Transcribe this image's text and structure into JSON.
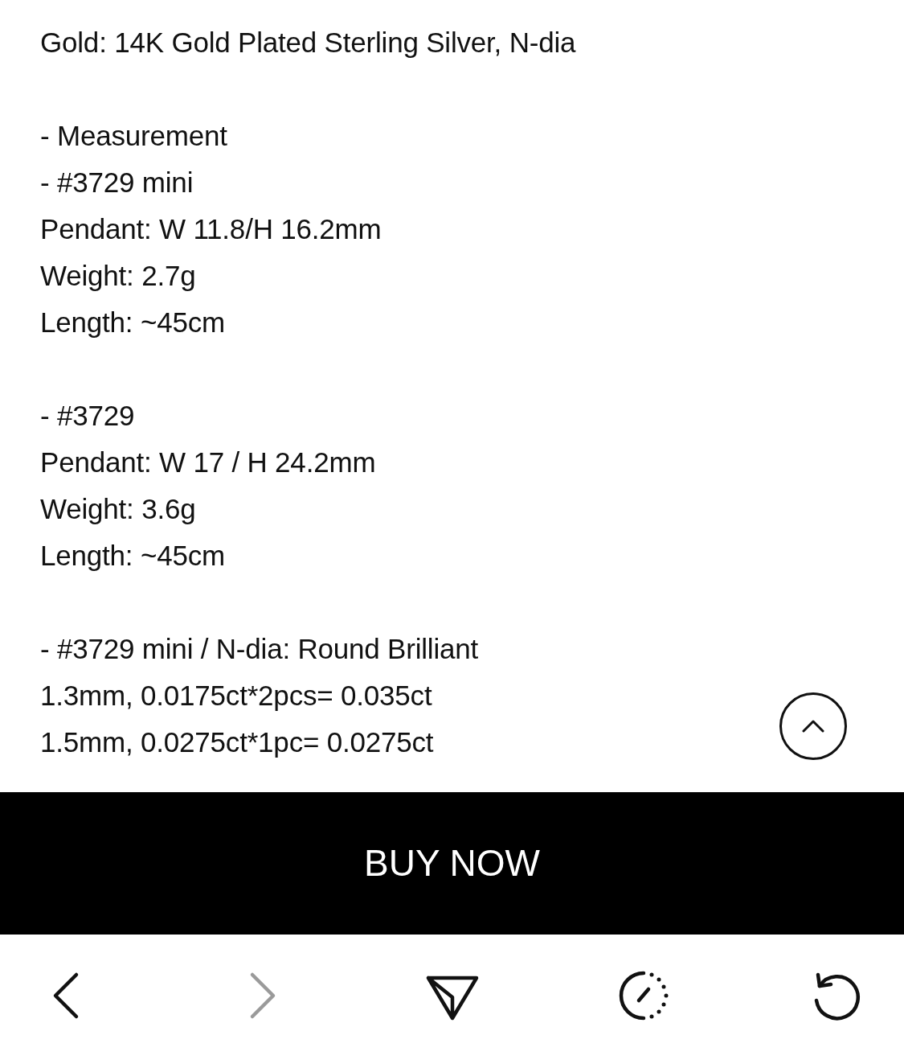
{
  "description": {
    "sections": [
      {
        "lines": [
          "Gold: 14K Gold Plated Sterling Silver, N-dia"
        ]
      },
      {
        "lines": [
          "- Measurement",
          "- #3729 mini",
          "Pendant: W 11.8/H 16.2mm",
          "Weight: 2.7g",
          "Length: ~45cm"
        ]
      },
      {
        "lines": [
          "- #3729",
          "Pendant: W 17 / H 24.2mm",
          "Weight: 3.6g",
          "Length: ~45cm"
        ]
      },
      {
        "lines": [
          "- #3729 mini / N-dia: Round Brilliant",
          "1.3mm, 0.0175ct*2pcs= 0.035ct",
          "1.5mm, 0.0275ct*1pc= 0.0275ct"
        ]
      }
    ]
  },
  "buy_button": {
    "label": "BUY NOW"
  },
  "toolbar": [
    {
      "kind": "back",
      "disabled": false
    },
    {
      "kind": "forward",
      "disabled": true
    },
    {
      "kind": "share",
      "disabled": false
    },
    {
      "kind": "timer",
      "disabled": false
    },
    {
      "kind": "reload",
      "disabled": false
    }
  ]
}
